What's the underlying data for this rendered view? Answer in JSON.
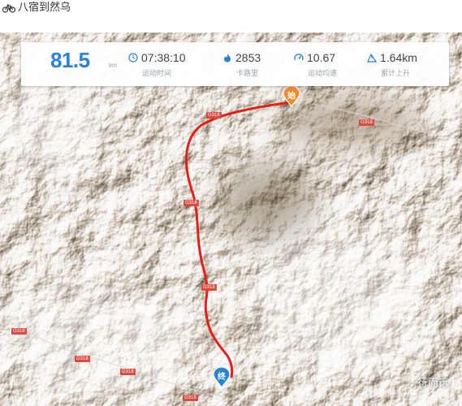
{
  "window": {
    "title": "八宿到然乌"
  },
  "stats": {
    "distance_value": "81.5",
    "distance_unit": "km",
    "duration_value": "07:38:10",
    "duration_label": "运动时间",
    "calories_value": "2853",
    "calories_label": "卡路里",
    "speed_value": "10.67",
    "speed_label": "运动均速",
    "ascent_value": "1.64km",
    "ascent_label": "累计上升",
    "accent_color": "#2a82d8"
  },
  "markers": {
    "start_label": "始",
    "end_label": "终",
    "start_color": "#f08a2e",
    "end_color": "#2a82d8"
  },
  "route": {
    "color": "#e0211b"
  },
  "road_labels": [
    "G318",
    "G318",
    "G318",
    "G318",
    "G318",
    "G318",
    "G318",
    "G318"
  ],
  "watermark": "行而远"
}
